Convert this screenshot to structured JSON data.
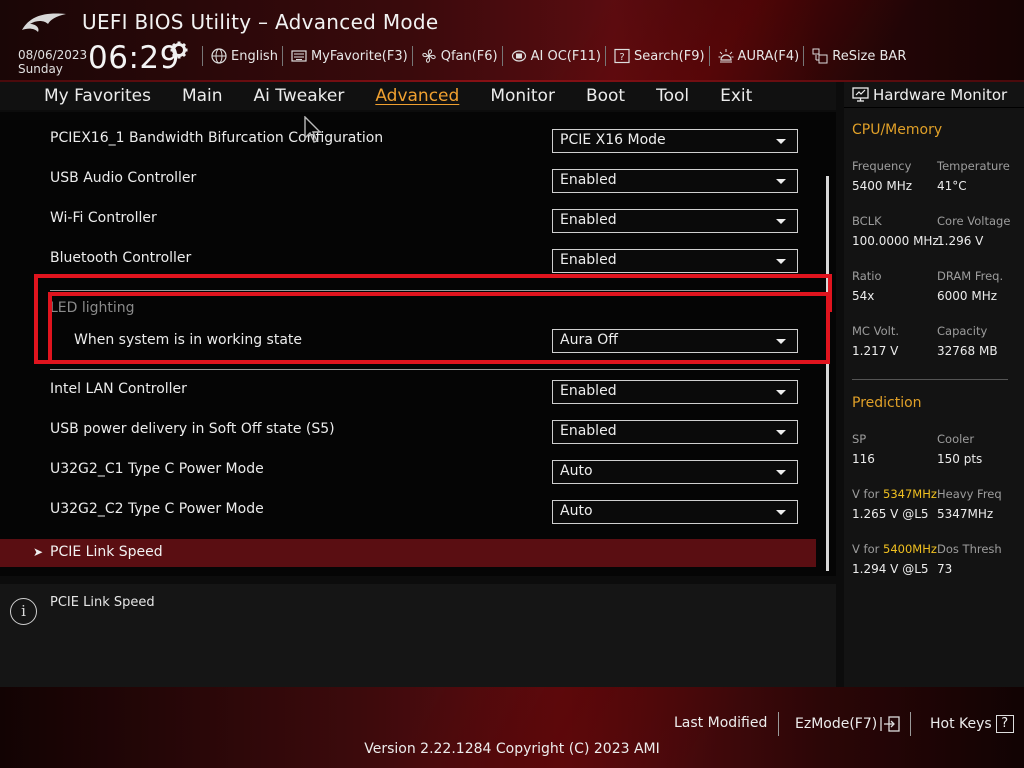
{
  "header": {
    "title": "UEFI BIOS Utility – Advanced Mode",
    "date": "08/06/2023",
    "weekday": "Sunday",
    "time": "06:29",
    "tools": [
      {
        "icon": "globe-icon",
        "label": "English"
      },
      {
        "icon": "keyboard-icon",
        "label": "MyFavorite(F3)"
      },
      {
        "icon": "fan-icon",
        "label": "Qfan(F6)"
      },
      {
        "icon": "chip-icon",
        "label": "AI OC(F11)"
      },
      {
        "icon": "question-icon",
        "label": "Search(F9)"
      },
      {
        "icon": "light-icon",
        "label": "AURA(F4)"
      },
      {
        "icon": "resize-bar-icon",
        "label": "ReSize BAR"
      }
    ]
  },
  "menu": {
    "tabs": [
      "My Favorites",
      "Main",
      "Ai Tweaker",
      "Advanced",
      "Monitor",
      "Boot",
      "Tool",
      "Exit"
    ],
    "active": "Advanced"
  },
  "settings": {
    "rows": [
      {
        "label": "PCIEX16_1 Bandwidth Bifurcation Configuration",
        "value": "PCIE X16 Mode"
      },
      {
        "label": "USB Audio Controller",
        "value": "Enabled"
      },
      {
        "label": "Wi-Fi Controller",
        "value": "Enabled"
      },
      {
        "label": "Bluetooth Controller",
        "value": "Enabled"
      }
    ],
    "led_section": {
      "title": "LED lighting",
      "item_label": "When system is in working state",
      "item_value": "Aura Off"
    },
    "rows2": [
      {
        "label": "Intel LAN Controller",
        "value": "Enabled"
      },
      {
        "label": "USB power delivery in Soft Off state (S5)",
        "value": "Enabled"
      },
      {
        "label": "U32G2_C1 Type C Power Mode",
        "value": "Auto"
      },
      {
        "label": "U32G2_C2 Type C Power Mode",
        "value": "Auto"
      }
    ],
    "submenu": "PCIE Link Speed"
  },
  "help": {
    "text": "PCIE Link Speed"
  },
  "hardware_monitor": {
    "title": "Hardware Monitor",
    "cpu_memory": {
      "title": "CPU/Memory",
      "items": [
        {
          "label": "Frequency",
          "value": "5400 MHz"
        },
        {
          "label": "Temperature",
          "value": "41°C"
        },
        {
          "label": "BCLK",
          "value": "100.0000 MHz"
        },
        {
          "label": "Core Voltage",
          "value": "1.296 V"
        },
        {
          "label": "Ratio",
          "value": "54x"
        },
        {
          "label": "DRAM Freq.",
          "value": "6000 MHz"
        },
        {
          "label": "MC Volt.",
          "value": "1.217 V"
        },
        {
          "label": "Capacity",
          "value": "32768 MB"
        }
      ]
    },
    "prediction": {
      "title": "Prediction",
      "sp_label": "SP",
      "sp_value": "116",
      "cooler_label": "Cooler",
      "cooler_value": "150 pts",
      "v_for_1_prefix": "V for ",
      "v_for_1_freq": "5347MHz",
      "v_for_1_value": "1.265 V @L5",
      "heavy_label": "Heavy Freq",
      "heavy_value": "5347MHz",
      "v_for_2_prefix": "V for ",
      "v_for_2_freq": "5400MHz",
      "v_for_2_value": "1.294 V @L5",
      "dos_label": "Dos Thresh",
      "dos_value": "73"
    }
  },
  "footer": {
    "last_modified": "Last Modified",
    "ezmode": "EzMode(F7)",
    "hotkeys": "Hot Keys",
    "hotkeys_key": "?",
    "version": "Version 2.22.1284 Copyright (C) 2023 AMI"
  },
  "colors": {
    "accent": "#f0a030",
    "highlight_box": "#e0141e",
    "submenu_bg": "#5a0e12",
    "monitor_section": "#e0a028",
    "monitor_highlight": "#f0c020"
  }
}
